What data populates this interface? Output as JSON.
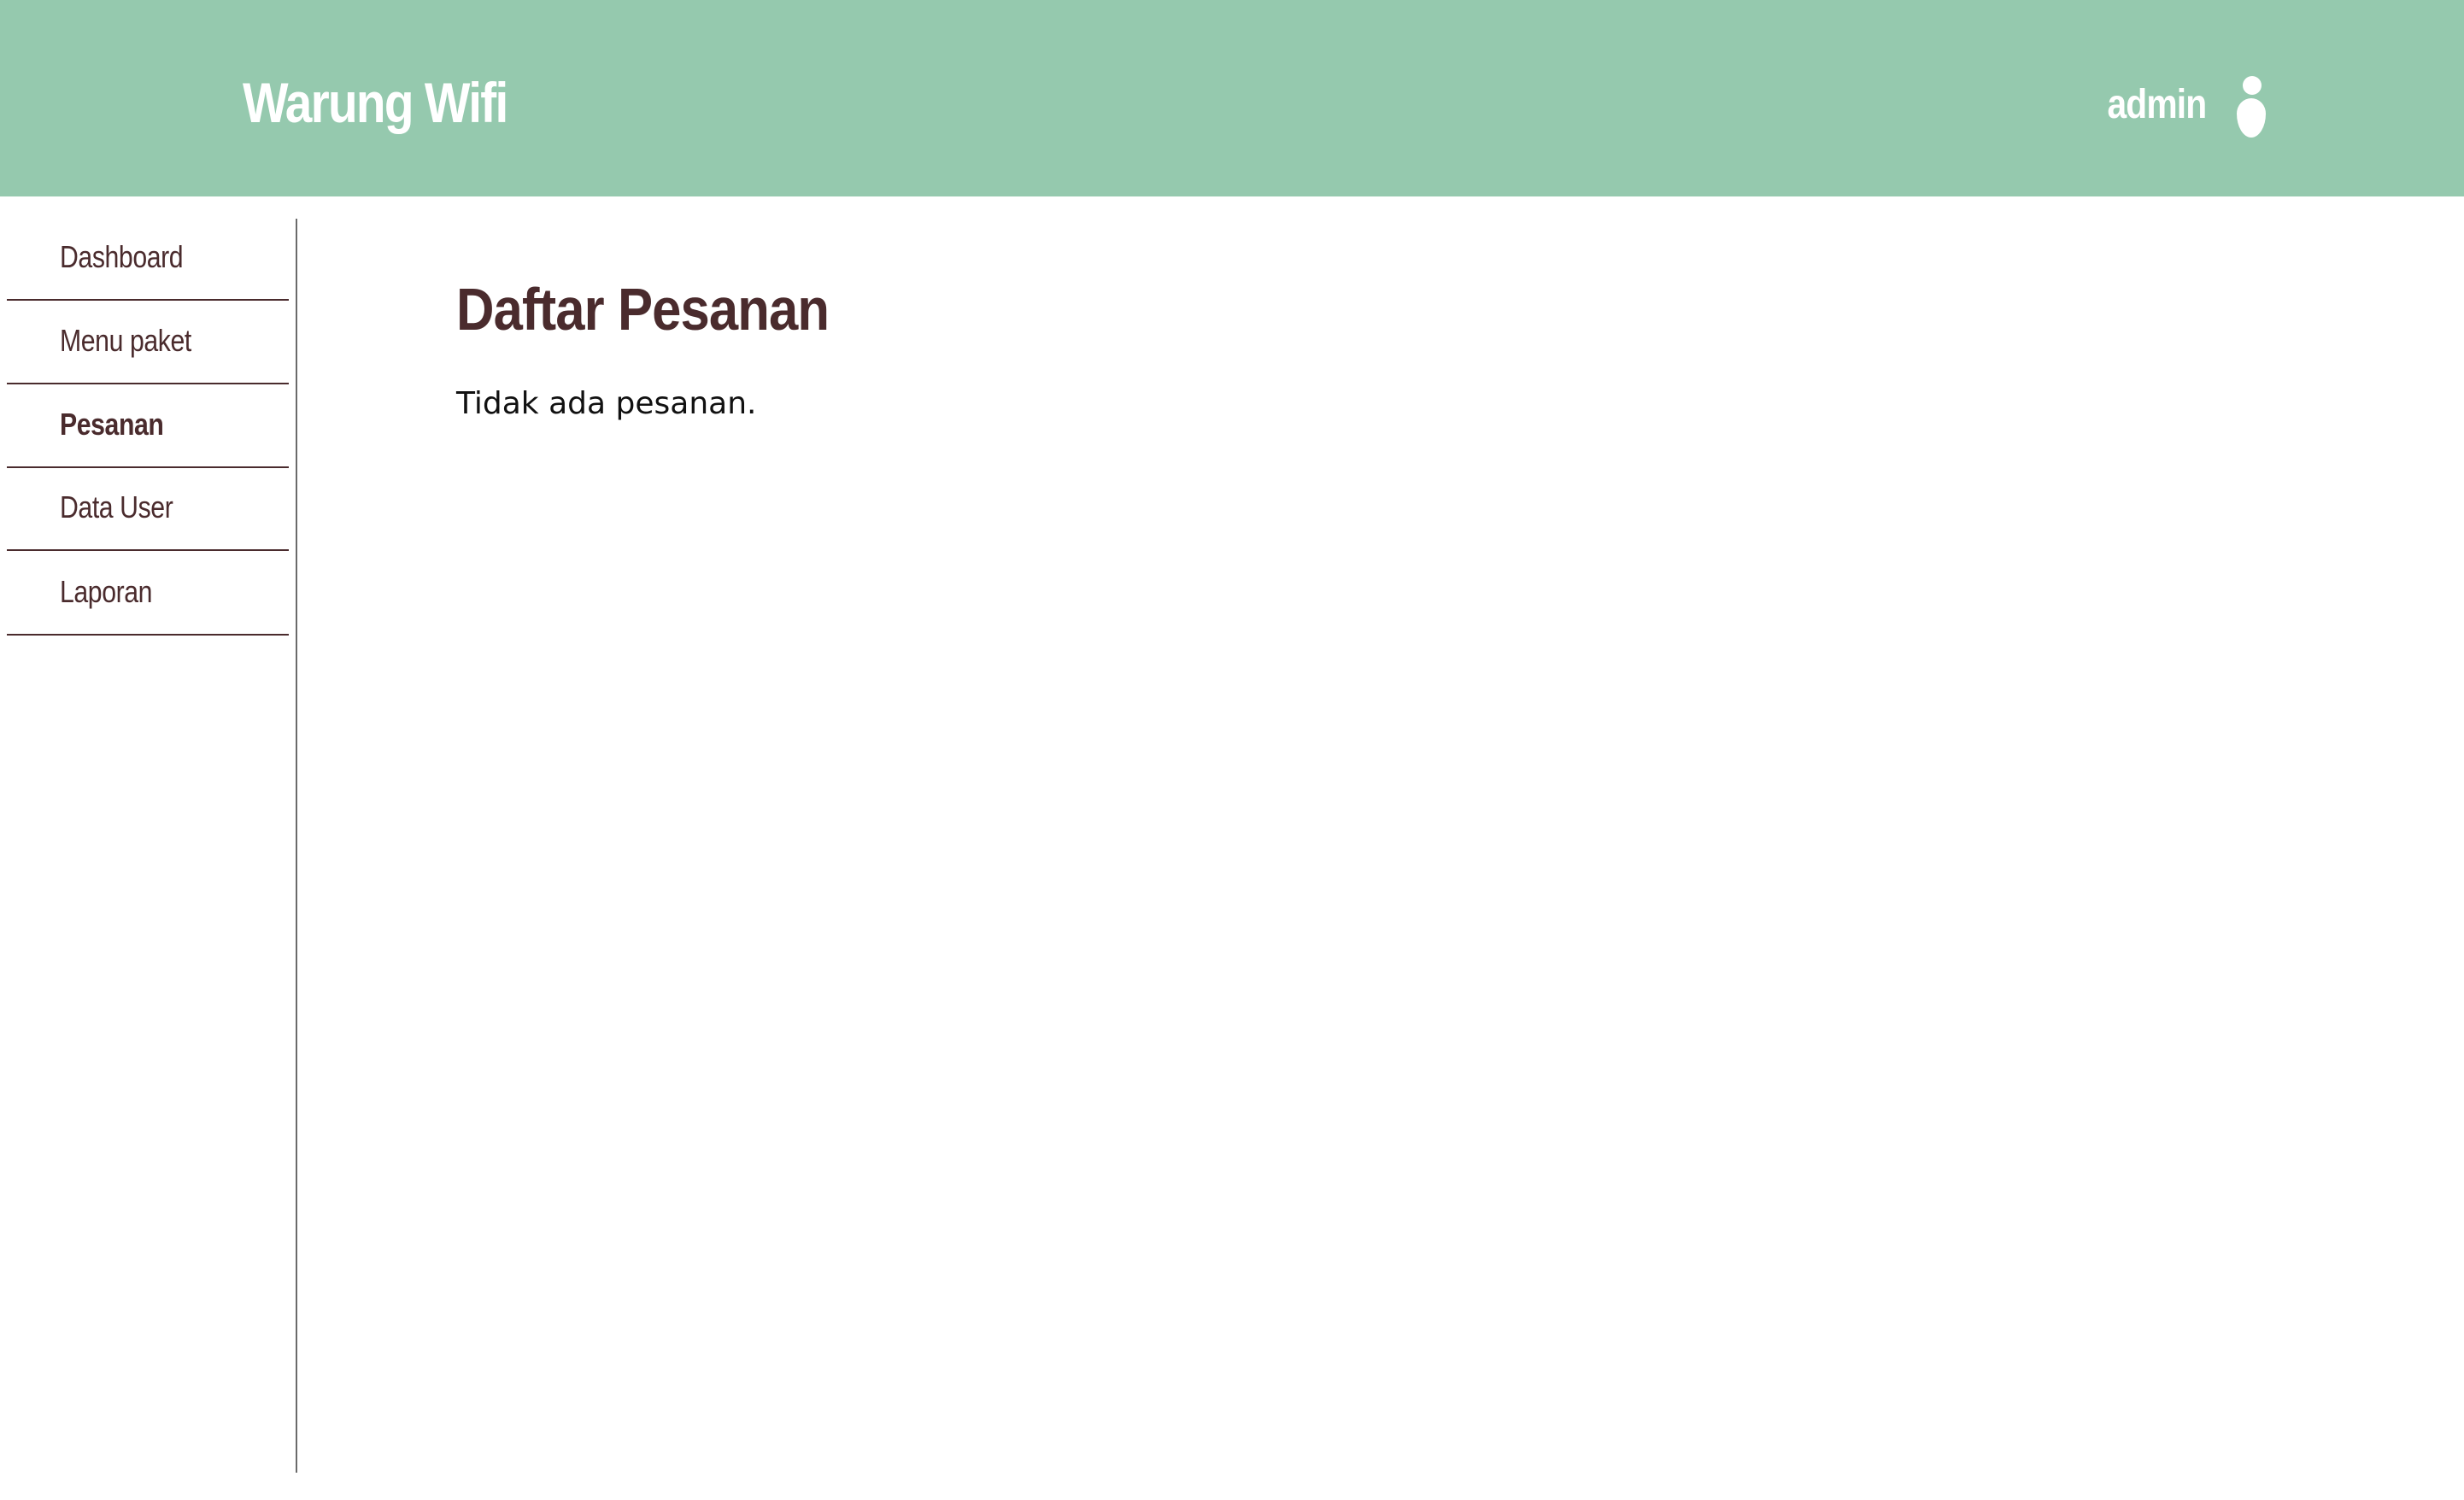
{
  "header": {
    "brand": "Warung Wifi",
    "username": "admin",
    "user_icon": "user-icon",
    "background_color": "#95c9ae"
  },
  "sidebar": {
    "items": [
      {
        "label": "Dashboard",
        "active": false
      },
      {
        "label": "Menu paket",
        "active": false
      },
      {
        "label": "Pesanan",
        "active": true
      },
      {
        "label": "Data User",
        "active": false
      },
      {
        "label": "Laporan",
        "active": false
      }
    ]
  },
  "main": {
    "title": "Daftar Pesanan",
    "empty_message": "Tidak ada pesanan."
  },
  "colors": {
    "accent": "#4a2b2d",
    "header_bg": "#95c9ae",
    "header_text": "#ffffff"
  }
}
